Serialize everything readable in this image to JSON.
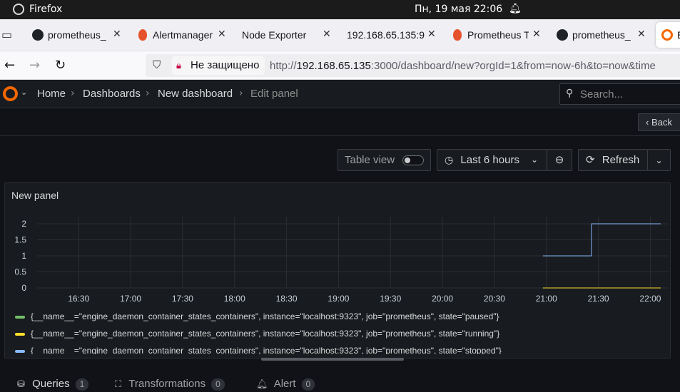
{
  "topbar": {
    "app_name": "Firefox",
    "clock": "Пн, 19 мая  22:06",
    "bell_icon": "bell-icon"
  },
  "tabs": [
    {
      "label": "prometheus_",
      "icon": "github-icon"
    },
    {
      "label": "Alertmanager",
      "icon": "prometheus-icon"
    },
    {
      "label": "Node Exporter",
      "icon": ""
    },
    {
      "label": "192.168.65.135:9",
      "icon": ""
    },
    {
      "label": "Prometheus T",
      "icon": "prometheus-icon"
    },
    {
      "label": "prometheus_",
      "icon": "github-icon"
    },
    {
      "label": "E",
      "icon": "grafana-icon"
    }
  ],
  "navbar": {
    "insecure_label": "Не защищено",
    "url_host": "192.168.65.135",
    "url_prefix": "http://",
    "url_rest": ":3000/dashboard/new?orgId=1&from=now-6h&to=now&time"
  },
  "grafana": {
    "breadcrumbs": [
      "Home",
      "Dashboards",
      "New dashboard",
      "Edit panel"
    ],
    "search_placeholder": "Search...",
    "back_label": "Back",
    "table_view_label": "Table view",
    "time_range_label": "Last 6 hours",
    "refresh_label": "Refresh",
    "accent_color": "#f46800"
  },
  "panel": {
    "title": "New panel",
    "bottom_tabs": [
      {
        "label": "Queries",
        "count": "1"
      },
      {
        "label": "Transformations",
        "count": "0"
      },
      {
        "label": "Alert",
        "count": "0"
      }
    ]
  },
  "chart_data": {
    "type": "line",
    "title": "New panel",
    "x_ticks": [
      "16:30",
      "17:00",
      "17:30",
      "18:00",
      "18:30",
      "19:00",
      "19:30",
      "20:00",
      "20:30",
      "21:00",
      "21:30",
      "22:00"
    ],
    "y_ticks": [
      "0",
      "0.5",
      "1",
      "1.5",
      "2"
    ],
    "ylim": [
      0,
      2
    ],
    "xlim": [
      "16:06",
      "22:06"
    ],
    "grid": true,
    "legend_position": "bottom",
    "series": [
      {
        "name": "{__name__=\"engine_daemon_container_states_containers\", instance=\"localhost:9323\", job=\"prometheus\", state=\"paused\"}",
        "color": "#73bf69",
        "x": [
          "20:58",
          "22:06"
        ],
        "values": [
          0,
          0
        ]
      },
      {
        "name": "{__name__=\"engine_daemon_container_states_containers\", instance=\"localhost:9323\", job=\"prometheus\", state=\"running\"}",
        "color": "#fade2a",
        "x": [
          "20:58",
          "22:06"
        ],
        "values": [
          0,
          0
        ]
      },
      {
        "name": "{__name__=\"engine_daemon_container_states_containers\", instance=\"localhost:9323\", job=\"prometheus\", state=\"stopped\"}",
        "color": "#8ab8ff",
        "x": [
          "20:58",
          "21:26",
          "21:29",
          "22:06"
        ],
        "values": [
          1,
          1,
          2,
          2
        ]
      }
    ]
  }
}
